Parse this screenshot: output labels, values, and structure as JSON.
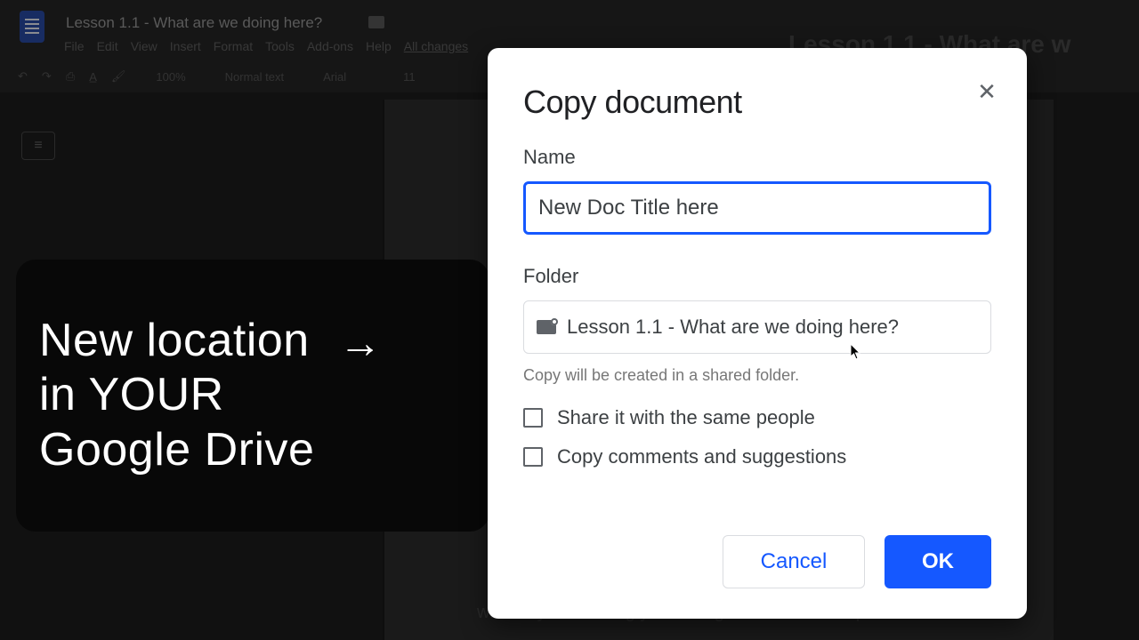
{
  "docs": {
    "title": "Lesson 1.1 - What are we doing here?",
    "menus": [
      "File",
      "Edit",
      "View",
      "Insert",
      "Format",
      "Tools",
      "Add-ons",
      "Help"
    ],
    "save_status": "All changes",
    "toolbar": {
      "zoom": "100%",
      "style": "Normal text",
      "font": "Arial",
      "size": "11"
    },
    "heading_partial": "Lesson 1.1 - What are w",
    "ghost_text": "will likely be walking you through each of the steps below"
  },
  "annotation": {
    "line1_prefix": "New location",
    "arrow": "→",
    "line2": "in YOUR",
    "line3": "Google Drive"
  },
  "modal": {
    "title": "Copy document",
    "name_label": "Name",
    "name_value": "New Doc Title here",
    "folder_label": "Folder",
    "folder_value": "Lesson 1.1 - What are we doing here?",
    "hint": "Copy will be created in a shared folder.",
    "share_checkbox_label": "Share it with the same people",
    "comments_checkbox_label": "Copy comments and suggestions",
    "cancel": "Cancel",
    "ok": "OK"
  }
}
